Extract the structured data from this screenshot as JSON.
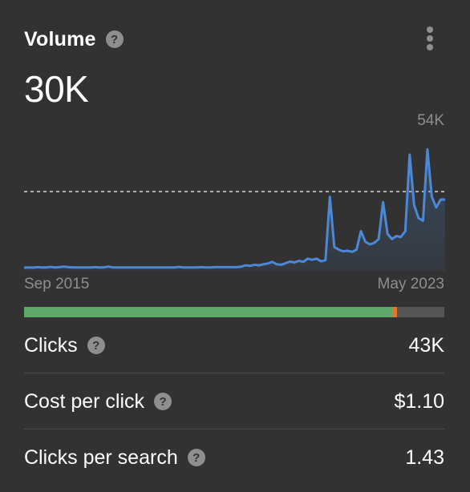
{
  "header": {
    "title": "Volume",
    "help_glyph": "?",
    "menu_icon": "more-vertical-icon"
  },
  "volume": {
    "value": "30K"
  },
  "chart_data": {
    "type": "area",
    "x_start_label": "Sep 2015",
    "x_end_label": "May 2023",
    "y_max_label": "54K",
    "ylim": [
      0,
      54000
    ],
    "reference_line": 30000,
    "color": "#4d88d6",
    "grid": false,
    "values": [
      1200,
      1300,
      1200,
      1400,
      1300,
      1300,
      1500,
      1300,
      1400,
      1600,
      1400,
      1300,
      1300,
      1300,
      1300,
      1300,
      1400,
      1300,
      1300,
      1600,
      1300,
      1300,
      1300,
      1300,
      1300,
      1300,
      1300,
      1300,
      1300,
      1300,
      1300,
      1300,
      1300,
      1300,
      1300,
      1500,
      1300,
      1300,
      1300,
      1300,
      1400,
      1300,
      1300,
      1400,
      1400,
      1400,
      1400,
      1400,
      1400,
      1600,
      2100,
      1900,
      2300,
      2100,
      2500,
      2800,
      3400,
      2500,
      2300,
      2900,
      3500,
      3200,
      3800,
      3400,
      4600,
      4200,
      4600,
      3600,
      4000,
      28000,
      9000,
      8000,
      7400,
      7600,
      7200,
      8000,
      15000,
      11000,
      10000,
      10600,
      12000,
      26000,
      14000,
      12000,
      13200,
      12800,
      15000,
      44000,
      25000,
      20000,
      19000,
      46000,
      28000,
      24000,
      27000,
      27000
    ],
    "axis_color": "#8e8e8e"
  },
  "difficulty_bar": {
    "fill_percent": 87.6,
    "fill_color": "#5fa86a",
    "marker_color": "#e0772e",
    "track_color": "#555555"
  },
  "metrics": [
    {
      "label": "Clicks",
      "value": "43K",
      "has_help": true
    },
    {
      "label": "Cost per click",
      "value": "$1.10",
      "has_help": true
    },
    {
      "label": "Clicks per search",
      "value": "1.43",
      "has_help": true
    }
  ]
}
